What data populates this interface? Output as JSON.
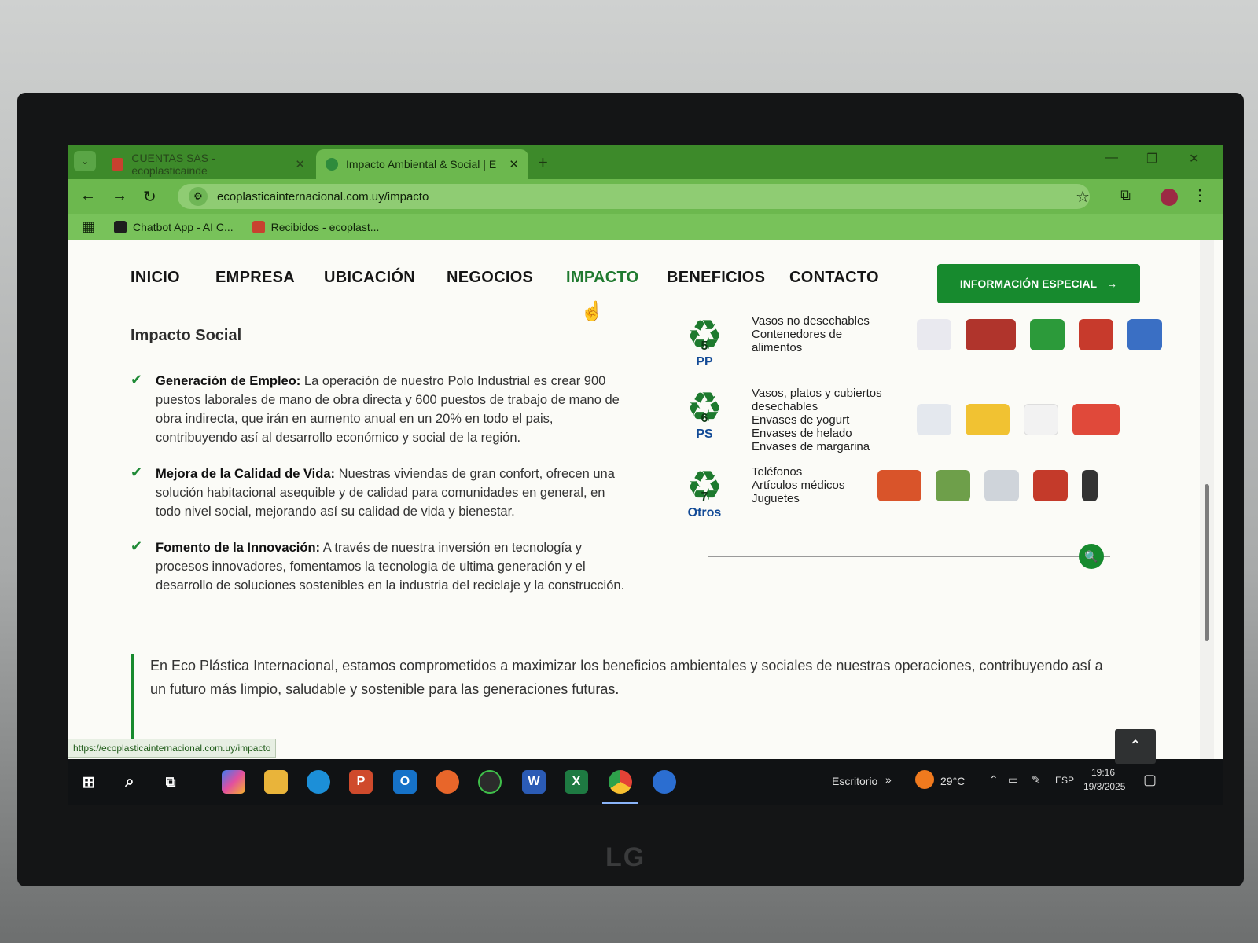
{
  "browser": {
    "tabs": [
      {
        "title": "CUENTAS SAS - ecoplasticainde",
        "active": false
      },
      {
        "title": "Impacto Ambiental & Social | E",
        "active": true
      }
    ],
    "url": "ecoplasticainternacional.com.uy/impacto",
    "bookmarks": [
      {
        "label": "Chatbot App - AI C..."
      },
      {
        "label": "Recibidos - ecoplast..."
      }
    ],
    "status_url": "https://ecoplasticainternacional.com.uy/impacto"
  },
  "site_nav": {
    "items": [
      "INICIO",
      "EMPRESA",
      "UBICACIÓN",
      "NEGOCIOS",
      "IMPACTO",
      "BENEFICIOS",
      "CONTACTO"
    ],
    "active": "IMPACTO",
    "cta": "INFORMACIÓN ESPECIAL"
  },
  "impacto_social": {
    "heading": "Impacto Social",
    "items": [
      {
        "title": "Generación de Empleo:",
        "text": "La operación de nuestro Polo Industrial es crear 900 puestos laborales de mano de obra directa y 600 puestos de trabajo de mano de obra indirecta, que irán en aumento anual en un 20% en todo el pais, contribuyendo así al desarrollo económico y social de la región."
      },
      {
        "title": "Mejora de la Calidad de Vida:",
        "text": "Nuestras viviendas de gran confort, ofrecen una solución habitacional asequible y de calidad para comunidades en general, en todo nivel social, mejorando así su calidad de vida y bienestar."
      },
      {
        "title": "Fomento de la Innovación:",
        "text": "A través de nuestra inversión en tecnología y procesos innovadores, fomentamos la tecnologia de ultima generación y el desarrollo de soluciones sostenibles en la industria del reciclaje y la construcción."
      }
    ]
  },
  "resin_codes": [
    {
      "number": "5",
      "code": "PP",
      "lines": [
        "Vasos no desechables",
        "Contenedores de",
        "alimentos"
      ],
      "pic_colors": [
        "#e9e9ef",
        "#b0342c",
        "#2c9a3a",
        "#c73a2c",
        "#3a6fc4"
      ]
    },
    {
      "number": "6",
      "code": "PS",
      "lines": [
        "Vasos, platos y cubiertos",
        "desechables",
        "Envases de yogurt",
        "Envases de helado",
        "Envases de margarina"
      ],
      "pic_colors": [
        "#e4e8ee",
        "#f1c232",
        "#f2f2f2",
        "#e0493a"
      ]
    },
    {
      "number": "7",
      "code": "Otros",
      "lines": [
        "Teléfonos",
        "Artículos médicos",
        "Juguetes"
      ],
      "pic_colors": [
        "#d9542a",
        "#6e9f4a",
        "#cfd4da",
        "#c43a2a",
        "#333333"
      ]
    }
  ],
  "quote": "En Eco Plástica Internacional, estamos comprometidos a maximizar los beneficios ambientales y sociales de nuestras operaciones, contribuyendo así a un futuro más limpio, saludable y sostenible para las generaciones futuras.",
  "taskbar": {
    "desktop_label": "Escritorio",
    "weather": "29°C",
    "language": "ESP",
    "time": "19:16",
    "date": "19/3/2025"
  },
  "monitor_brand": "LG",
  "colors": {
    "brand_green": "#178a2e",
    "chrome_green": "#6cb84e",
    "active_nav": "#1f7a2f"
  }
}
